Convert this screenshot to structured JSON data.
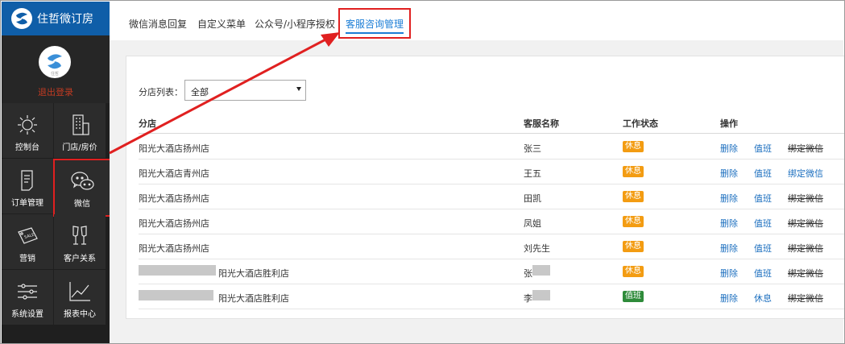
{
  "brand": {
    "name": "住哲微订房"
  },
  "user": {
    "avatar_caption": "住哲",
    "logout_label": "退出登录"
  },
  "sidebar": {
    "items": [
      {
        "label": "控制台",
        "icon": "sun-icon"
      },
      {
        "label": "门店/房价",
        "icon": "building-icon"
      },
      {
        "label": "订单管理",
        "icon": "document-icon"
      },
      {
        "label": "微信",
        "icon": "wechat-icon",
        "active": true
      },
      {
        "label": "营销",
        "icon": "sale-tag-icon"
      },
      {
        "label": "客户关系",
        "icon": "glasses-icon"
      },
      {
        "label": "系统设置",
        "icon": "sliders-icon"
      },
      {
        "label": "报表中心",
        "icon": "line-chart-icon"
      }
    ]
  },
  "tabs": [
    {
      "label": "微信消息回复"
    },
    {
      "label": "自定义菜单"
    },
    {
      "label": "公众号/小程序授权"
    },
    {
      "label": "客服咨询管理",
      "active": true
    }
  ],
  "filter": {
    "label": "分店列表：",
    "selected": "全部"
  },
  "table": {
    "headers": {
      "branch": "分店",
      "agent": "客服名称",
      "status": "工作状态",
      "actions": "操作"
    },
    "rows": [
      {
        "branch": "阳光大酒店扬州店",
        "agent": "张三",
        "status": "休息",
        "status_type": "rest",
        "action1": "删除",
        "action2": "值班",
        "action3": "绑定微信",
        "action3_linked": false
      },
      {
        "branch": "阳光大酒店青州店",
        "agent": "王五",
        "status": "休息",
        "status_type": "rest",
        "action1": "删除",
        "action2": "值班",
        "action3": "绑定微信",
        "action3_linked": true
      },
      {
        "branch": "阳光大酒店扬州店",
        "agent": "田凯",
        "status": "休息",
        "status_type": "rest",
        "action1": "删除",
        "action2": "值班",
        "action3": "绑定微信",
        "action3_linked": false
      },
      {
        "branch": "阳光大酒店扬州店",
        "agent": "凤姐",
        "status": "休息",
        "status_type": "rest",
        "action1": "删除",
        "action2": "值班",
        "action3": "绑定微信",
        "action3_linked": false
      },
      {
        "branch": "阳光大酒店扬州店",
        "agent": "刘先生",
        "status": "休息",
        "status_type": "rest",
        "action1": "删除",
        "action2": "值班",
        "action3": "绑定微信",
        "action3_linked": false
      },
      {
        "branch": "阳光大酒店胜利店",
        "agent": "张",
        "status": "休息",
        "status_type": "rest",
        "action1": "删除",
        "action2": "值班",
        "action3": "绑定微信",
        "action3_linked": false,
        "redacted": true
      },
      {
        "branch": "阳光大酒店胜利店",
        "agent": "李",
        "status": "值班",
        "status_type": "duty",
        "action1": "删除",
        "action2": "休息",
        "action3": "绑定微信",
        "action3_linked": false,
        "redacted": true
      }
    ]
  },
  "colors": {
    "brand": "#0f5ea8",
    "accent": "#1c7ed6",
    "highlight": "#e02020",
    "rest": "#f39c12",
    "duty": "#2e8b3a"
  }
}
